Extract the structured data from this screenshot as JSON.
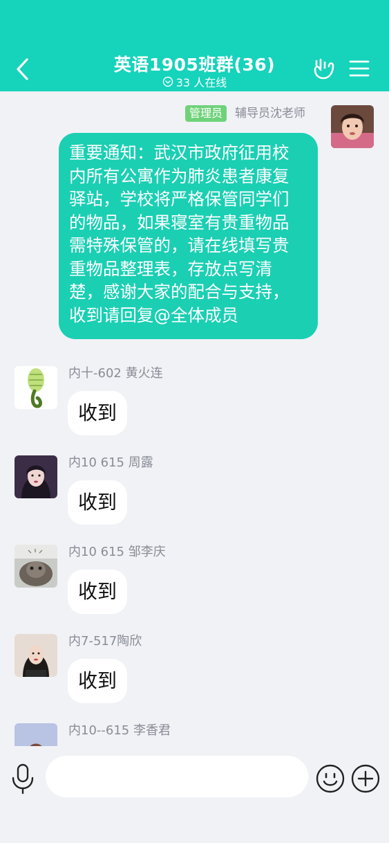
{
  "header": {
    "title": "英语1905班群(36)",
    "online": "33 人在线",
    "colors": {
      "bar": "#16d3bb",
      "text": "#ffffff"
    }
  },
  "admin_message": {
    "role_tag": "管理员",
    "sender": "辅导员沈老师",
    "text": "重要通知：武汉市政府征用校内所有公寓作为肺炎患者康复驿站，学校将严格保管同学们的物品，如果寝室有贵重物品需特殊保管的，请在线填写贵重物品整理表，存放点写清楚，感谢大家的配合与支持，收到请回复@全体成员",
    "bubble_color": "#1bcfb3"
  },
  "messages": [
    {
      "sender": "内十-602 黄火连",
      "text": "收到"
    },
    {
      "sender": "内10 615 周露",
      "text": "收到"
    },
    {
      "sender": "内10 615 邹李庆",
      "text": "收到"
    },
    {
      "sender": "内7-517陶欣",
      "text": "收到"
    },
    {
      "sender": "内10--615 李香君",
      "text": ""
    }
  ],
  "input_bar": {
    "placeholder": "",
    "icons": [
      "microphone-icon",
      "smiley-icon",
      "plus-icon"
    ]
  }
}
